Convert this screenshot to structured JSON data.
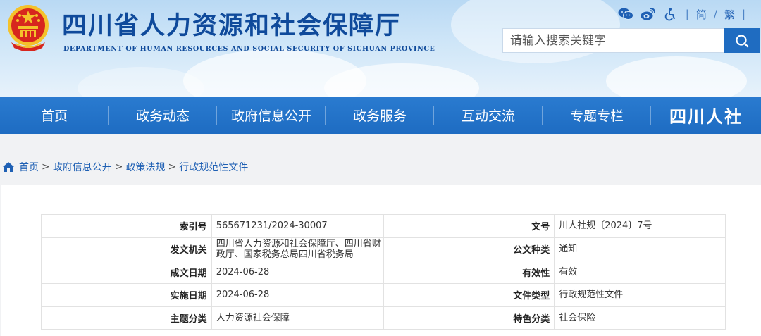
{
  "header": {
    "title": "四川省人力资源和社会保障厅",
    "subtitle": "DEPARTMENT OF HUMAN RESOURCES AND SOCIAL SECURITY OF SICHUAN PROVINCE",
    "tools": {
      "lang_simplified": "简",
      "lang_divider": "/",
      "lang_traditional": "繁"
    },
    "icons": [
      "wechat-icon",
      "weibo-icon",
      "accessibility-icon",
      "search-icon"
    ],
    "search": {
      "placeholder": "请输入搜索关键字",
      "value": ""
    }
  },
  "nav": {
    "items": [
      "首页",
      "政务动态",
      "政府信息公开",
      "政务服务",
      "互动交流",
      "专题专栏"
    ],
    "logo_text": "四川人社"
  },
  "breadcrumb": {
    "items": [
      "首页",
      "政府信息公开",
      "政策法规",
      "行政规范性文件"
    ],
    "separator": ">"
  },
  "meta_table": {
    "rows": [
      {
        "l1": "索引号",
        "v1": "565671231/2024-30007",
        "l2": "文号",
        "v2": "川人社规〔2024〕7号"
      },
      {
        "l1": "发文机关",
        "v1": "四川省人力资源和社会保障厅、四川省财政厅、国家税务总局四川省税务局",
        "l2": "公文种类",
        "v2": "通知"
      },
      {
        "l1": "成文日期",
        "v1": "2024-06-28",
        "l2": "有效性",
        "v2": "有效"
      },
      {
        "l1": "实施日期",
        "v1": "2024-06-28",
        "l2": "文件类型",
        "v2": "行政规范性文件"
      },
      {
        "l1": "主题分类",
        "v1": "人力资源社会保障",
        "l2": "特色分类",
        "v2": "社会保险"
      }
    ]
  },
  "colors": {
    "brand_blue": "#0f4a9b",
    "nav_blue": "#1e6cc2",
    "link_blue": "#1f60b4",
    "emblem_red": "#d7261e",
    "emblem_gold": "#f4c22b"
  }
}
